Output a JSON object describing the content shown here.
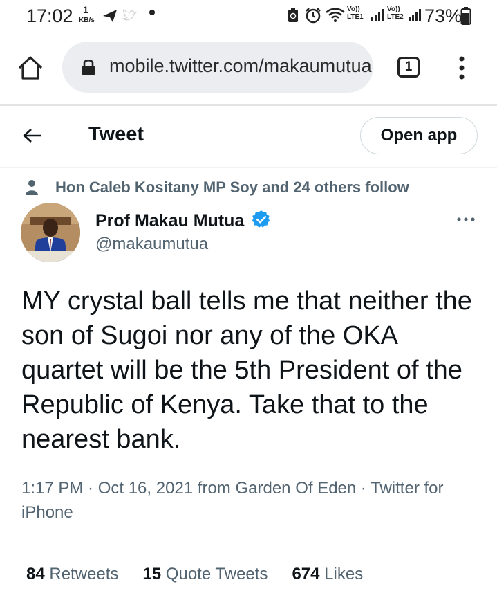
{
  "status_bar": {
    "time": "17:02",
    "net_speed_value": "1",
    "net_speed_unit": "KB/s",
    "signal_1_label": "Vo)) LTE1",
    "signal_2_label": "Vo)) LTE2",
    "battery": "73%"
  },
  "browser": {
    "url": "mobile.twitter.com/makaumutua",
    "tab_count": "1"
  },
  "header": {
    "title": "Tweet",
    "open_app_label": "Open app"
  },
  "tweet": {
    "social_context": "Hon Caleb Kositany MP Soy and 24 others follow",
    "author_name": "Prof Makau Mutua",
    "author_handle": "@makaumutua",
    "text": "MY crystal ball tells me that neither the son of Sugoi nor any of the OKA quartet will be the 5th President of the Republic of Kenya.  Take that to the nearest bank.",
    "meta": "1:17 PM · Oct 16, 2021 from Garden Of Eden · Twitter for iPhone",
    "stats": {
      "retweets_count": "84",
      "retweets_label": "Retweets",
      "quotes_count": "15",
      "quotes_label": "Quote Tweets",
      "likes_count": "674",
      "likes_label": "Likes"
    }
  },
  "colors": {
    "verified_blue": "#1d9bf0",
    "secondary_text": "#536471",
    "primary_text": "#0f1419"
  },
  "icons": [
    "send-icon",
    "alarm-icon",
    "wifi-icon",
    "signal-icon",
    "battery-icon",
    "home-icon",
    "lock-icon",
    "tab-switcher-icon",
    "overflow-menu-icon",
    "back-arrow-icon",
    "person-icon",
    "verified-badge-icon",
    "more-icon"
  ]
}
